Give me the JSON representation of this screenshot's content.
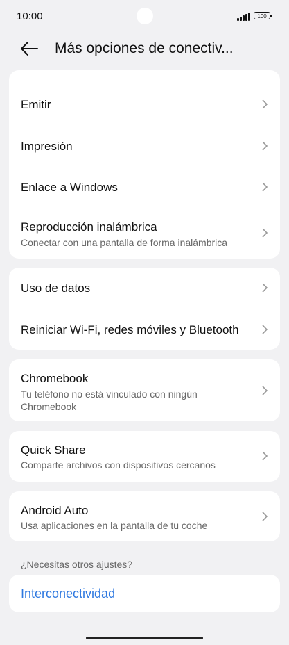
{
  "status": {
    "time": "10:00",
    "battery": "100"
  },
  "header": {
    "title": "Más opciones de conectiv..."
  },
  "group1": [
    {
      "label": "Emitir"
    },
    {
      "label": "Impresión"
    },
    {
      "label": "Enlace a Windows"
    },
    {
      "label": "Reproducción inalámbrica",
      "sub": "Conectar con una pantalla de forma inalámbrica"
    }
  ],
  "group2": [
    {
      "label": "Uso de datos"
    },
    {
      "label": "Reiniciar Wi-Fi, redes móviles y Bluetooth"
    }
  ],
  "chromebook": {
    "label": "Chromebook",
    "sub": "Tu teléfono no está vinculado con ningún Chromebook"
  },
  "quickshare": {
    "label": "Quick Share",
    "sub": "Comparte archivos con dispositivos cercanos"
  },
  "androidauto": {
    "label": "Android Auto",
    "sub": "Usa aplicaciones en la pantalla de tu coche"
  },
  "other": {
    "section_label": "¿Necesitas otros ajustes?",
    "link": "Interconectividad"
  }
}
